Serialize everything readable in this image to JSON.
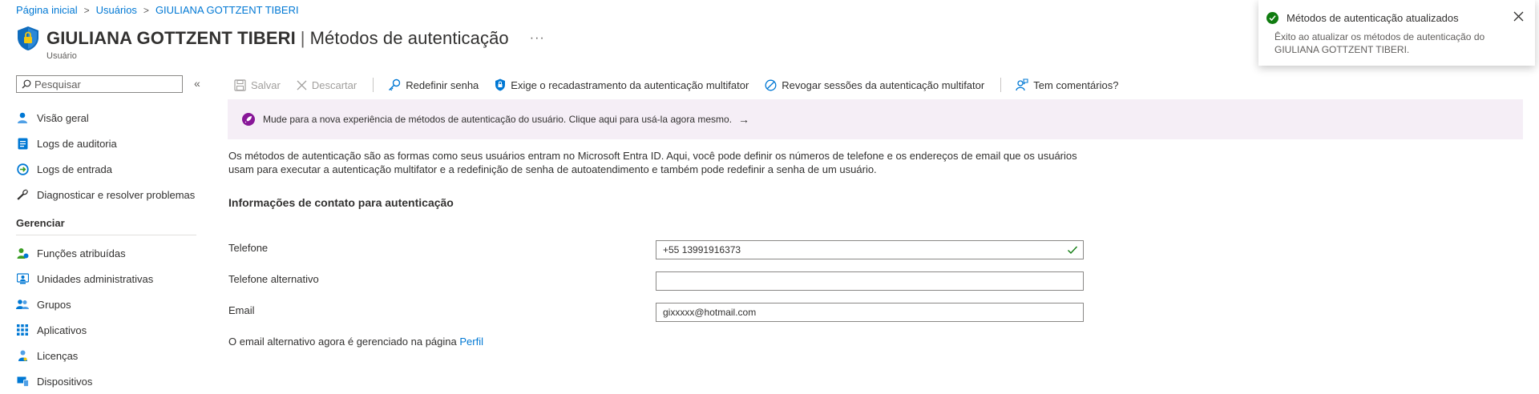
{
  "breadcrumb": {
    "home": "Página inicial",
    "users": "Usuários",
    "current": "GIULIANA GOTTZENT TIBERI"
  },
  "header": {
    "user_name": "GIULIANA GOTTZENT TIBERI",
    "page_title": "Métodos de autenticação",
    "subtitle": "Usuário",
    "more": "···"
  },
  "sidebar": {
    "search_placeholder": "Pesquisar",
    "collapse": "«",
    "items": [
      {
        "label": "Visão geral",
        "icon": "user-icon"
      },
      {
        "label": "Logs de auditoria",
        "icon": "log-icon"
      },
      {
        "label": "Logs de entrada",
        "icon": "sign-in-icon"
      },
      {
        "label": "Diagnosticar e resolver problemas",
        "icon": "wrench-icon"
      }
    ],
    "section": "Gerenciar",
    "manage_items": [
      {
        "label": "Funções atribuídas",
        "icon": "role-icon"
      },
      {
        "label": "Unidades administrativas",
        "icon": "admin-unit-icon"
      },
      {
        "label": "Grupos",
        "icon": "groups-icon"
      },
      {
        "label": "Aplicativos",
        "icon": "apps-icon"
      },
      {
        "label": "Licenças",
        "icon": "license-icon"
      },
      {
        "label": "Dispositivos",
        "icon": "devices-icon"
      }
    ]
  },
  "toolbar": {
    "save": "Salvar",
    "discard": "Descartar",
    "reset_password": "Redefinir senha",
    "require_mfa": "Exige o recadastramento da autenticação multifator",
    "revoke_mfa": "Revogar sessões da autenticação multifator",
    "feedback": "Tem comentários?"
  },
  "banner": {
    "text": "Mude para a nova experiência de métodos de autenticação do usuário. Clique aqui para usá-la agora mesmo.",
    "arrow": "→"
  },
  "description": "Os métodos de autenticação são as formas como seus usuários entram no Microsoft Entra ID. Aqui, você pode definir os números de telefone e os endereços de email que os usuários usam para executar a autenticação multifator e a redefinição de senha de autoatendimento e também pode redefinir a senha de um usuário.",
  "contact": {
    "title": "Informações de contato para autenticação",
    "phone_label": "Telefone",
    "phone_value": "+55 13991916373",
    "alt_phone_label": "Telefone alternativo",
    "alt_phone_value": "",
    "email_label": "Email",
    "email_value": "gixxxxx@hotmail.com"
  },
  "note": {
    "text": "O email alternativo agora é gerenciado na página ",
    "link": "Perfil"
  },
  "toast": {
    "title": "Métodos de autenticação atualizados",
    "body": "Êxito ao atualizar os métodos de autenticação do GIULIANA GOTTZENT TIBERI."
  },
  "colors": {
    "accent": "#0078d4",
    "success": "#107c10",
    "banner_bg": "#f5eef6",
    "banner_icon": "#881798"
  }
}
